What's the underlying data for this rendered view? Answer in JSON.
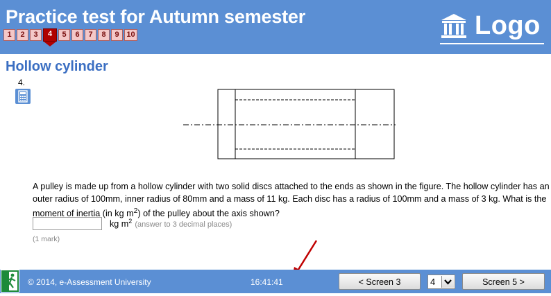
{
  "header": {
    "title": "Practice test for Autumn semester",
    "logo_text": "Logo",
    "logo_icon": "bank-building-icon",
    "question_nav": [
      {
        "label": "1",
        "current": false
      },
      {
        "label": "2",
        "current": false
      },
      {
        "label": "3",
        "current": false
      },
      {
        "label": "4",
        "current": true
      },
      {
        "label": "5",
        "current": false
      },
      {
        "label": "6",
        "current": false
      },
      {
        "label": "7",
        "current": false
      },
      {
        "label": "8",
        "current": false
      },
      {
        "label": "9",
        "current": false
      },
      {
        "label": "10",
        "current": false
      }
    ]
  },
  "main": {
    "title": "Hollow cylinder",
    "question_number": "4.",
    "calculator_icon": "calculator-icon",
    "question_text_1": "A pulley is made up from a hollow cylinder with two solid discs attached to the ends as shown in the figure. The hollow cylinder has an outer radius of 100mm, inner radius of 80mm and a mass of 11 kg. Each disc has a radius of 100mm and a mass of 3 kg. What is the moment of inertia (in kg m",
    "question_text_sup": "2",
    "question_text_2": ") of the pulley about the axis shown?",
    "answer_value": "",
    "unit_base": "kg m",
    "unit_sup": "2",
    "hint": "(answer to 3 decimal places)",
    "marks": "(1 mark)"
  },
  "footer": {
    "exit_icon": "exit-running-man-icon",
    "copyright": "© 2014, e-Assessment University",
    "clock": "16:41:41",
    "prev_label": "< Screen 3",
    "screen_select_value": "4",
    "next_label": "Screen 5 >"
  },
  "colors": {
    "header_bg": "#5b8fd4",
    "title_blue": "#3a6ec2",
    "current_question": "#b00000",
    "arrow_red": "#c00000"
  }
}
